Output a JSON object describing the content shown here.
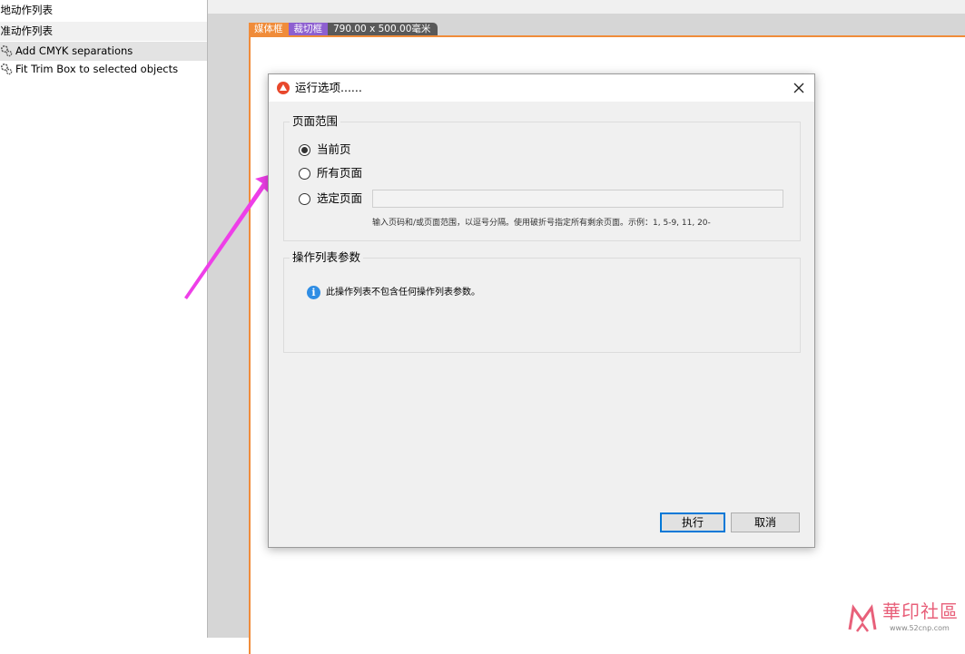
{
  "left_panel": {
    "rows": [
      {
        "label": "本地动作列表",
        "type": "section"
      },
      {
        "label": "标准动作列表",
        "type": "section"
      },
      {
        "label": "Add CMYK separations",
        "type": "item",
        "selected": true
      },
      {
        "label": "Fit Trim Box to selected objects",
        "type": "item",
        "selected": false
      }
    ]
  },
  "canvas": {
    "tabs": {
      "media": "媒体框",
      "crop": "裁切框",
      "dimensions": "790.00 x 500.00毫米"
    },
    "colors": {
      "media": "#f08c3a",
      "crop": "#8d5fd0",
      "dimensions": "#595959"
    }
  },
  "dialog": {
    "title": "运行选项......",
    "close_icon": "close-icon",
    "page_range": {
      "label": "页面范围",
      "options": [
        {
          "label": "当前页",
          "checked": true
        },
        {
          "label": "所有页面",
          "checked": false
        },
        {
          "label": "选定页面",
          "checked": false
        }
      ],
      "input_value": "",
      "hint": "输入页码和/或页面范围，以逗号分隔。使用破折号指定所有剩余页面。示例：1, 5-9, 11, 20-"
    },
    "params": {
      "label": "操作列表参数",
      "info_icon": "info-icon",
      "message": "此操作列表不包含任何操作列表参数。"
    },
    "buttons": {
      "run": "执行",
      "cancel": "取消"
    }
  },
  "watermark": {
    "title": "華印社區",
    "url": "www.52cnp.com"
  }
}
